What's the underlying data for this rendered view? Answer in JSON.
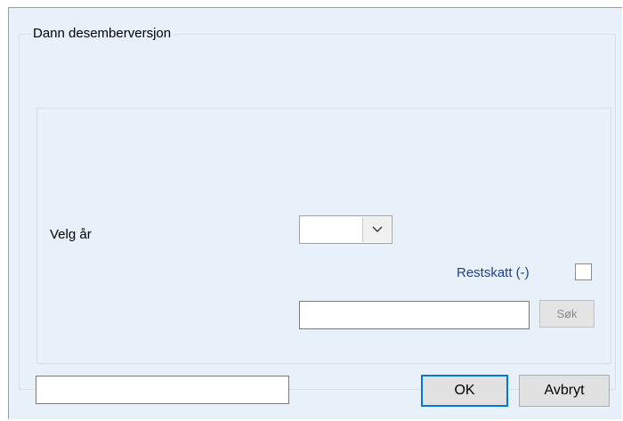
{
  "dialog": {
    "group_title": "Dann desemberversjon"
  },
  "year": {
    "label": "Velg år",
    "selected_value": ""
  },
  "restskatt": {
    "label": "Restskatt (-)",
    "checked": false
  },
  "search": {
    "value": "",
    "button_label": "Søk"
  },
  "footer": {
    "status_value": "",
    "ok_label": "OK",
    "cancel_label": "Avbryt"
  },
  "icons": {
    "combo_dropdown": "chevron-down-icon"
  }
}
